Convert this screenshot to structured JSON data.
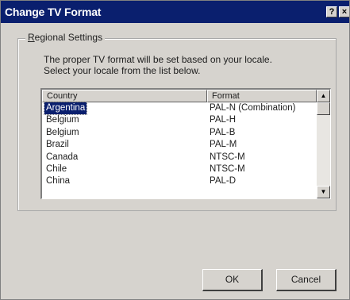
{
  "window": {
    "title": "Change TV Format",
    "help_glyph": "?",
    "close_glyph": "×"
  },
  "group": {
    "legend_accesskey": "R",
    "legend_rest": "egional Settings",
    "description_line1": "The proper TV format will be set based on your locale.",
    "description_line2": "Select your locale from the list below."
  },
  "list": {
    "columns": [
      "Country",
      "Format"
    ],
    "rows": [
      {
        "country": "Argentina",
        "format": "PAL-N (Combination)",
        "selected": true
      },
      {
        "country": "Belgium",
        "format": "PAL-H",
        "selected": false
      },
      {
        "country": "Belgium",
        "format": "PAL-B",
        "selected": false
      },
      {
        "country": "Brazil",
        "format": "PAL-M",
        "selected": false
      },
      {
        "country": "Canada",
        "format": "NTSC-M",
        "selected": false
      },
      {
        "country": "Chile",
        "format": "NTSC-M",
        "selected": false
      },
      {
        "country": "China",
        "format": "PAL-D",
        "selected": false
      }
    ],
    "scroll_up_glyph": "▲",
    "scroll_down_glyph": "▼"
  },
  "buttons": {
    "ok_label": "OK",
    "cancel_label": "Cancel"
  },
  "colors": {
    "titlebar": "#0a1f6e",
    "selection": "#0a1f6e",
    "face": "#d6d3ce"
  }
}
